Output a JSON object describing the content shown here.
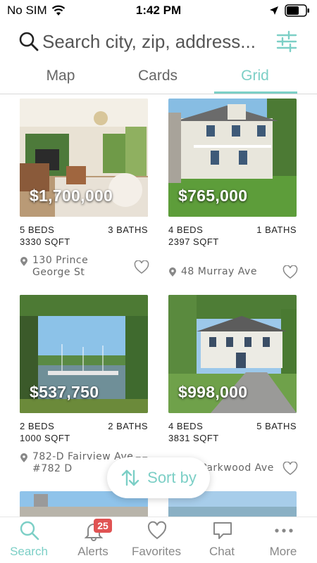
{
  "status_bar": {
    "carrier": "No SIM",
    "time": "1:42 PM"
  },
  "search": {
    "placeholder": "Search city, zip, address..."
  },
  "view_tabs": [
    {
      "label": "Map",
      "active": false
    },
    {
      "label": "Cards",
      "active": false
    },
    {
      "label": "Grid",
      "active": true
    }
  ],
  "listings": [
    {
      "price": "$1,700,000",
      "beds": "5 BEDS",
      "baths": "3 BATHS",
      "sqft": "3330 SQFT",
      "address": "130 Prince George St"
    },
    {
      "price": "$765,000",
      "beds": "4 BEDS",
      "baths": "1 BATHS",
      "sqft": "2397 SQFT",
      "address": "48 Murray Ave"
    },
    {
      "price": "$537,750",
      "beds": "2 BEDS",
      "baths": "2 BATHS",
      "sqft": "1000 SQFT",
      "address": "782-D Fairview Ave #782 D"
    },
    {
      "price": "$998,000",
      "beds": "4 BEDS",
      "baths": "5 BATHS",
      "sqft": "3831 SQFT",
      "address": "Parkwood Ave"
    }
  ],
  "sort_button": {
    "label": "Sort by"
  },
  "tab_bar": [
    {
      "label": "Search",
      "icon": "search-icon",
      "active": true
    },
    {
      "label": "Alerts",
      "icon": "bell-icon",
      "badge": "25"
    },
    {
      "label": "Favorites",
      "icon": "heart-icon"
    },
    {
      "label": "Chat",
      "icon": "chat-icon"
    },
    {
      "label": "More",
      "icon": "more-dots-icon"
    }
  ],
  "colors": {
    "accent": "#7ccfc6",
    "badge": "#e05353"
  }
}
